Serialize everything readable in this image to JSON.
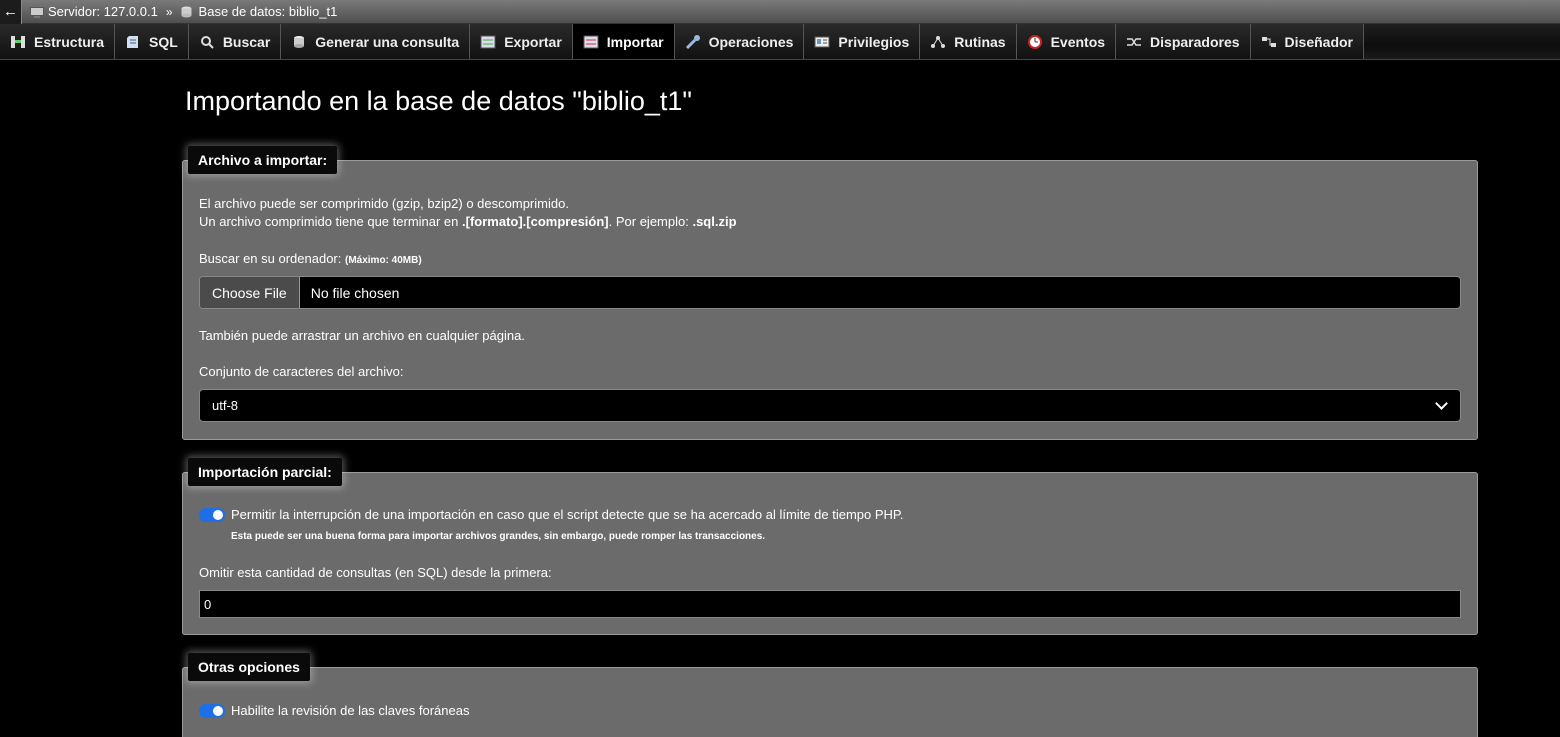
{
  "breadcrumb": {
    "back": "←",
    "server": "Servidor: 127.0.0.1",
    "separator": "»",
    "database": "Base de datos: biblio_t1"
  },
  "tabs": [
    {
      "label": "Estructura",
      "icon": "structure-icon"
    },
    {
      "label": "SQL",
      "icon": "sql-icon"
    },
    {
      "label": "Buscar",
      "icon": "search-icon"
    },
    {
      "label": "Generar una consulta",
      "icon": "query-icon"
    },
    {
      "label": "Exportar",
      "icon": "export-icon"
    },
    {
      "label": "Importar",
      "icon": "import-icon",
      "active": true
    },
    {
      "label": "Operaciones",
      "icon": "wrench-icon"
    },
    {
      "label": "Privilegios",
      "icon": "privileges-icon"
    },
    {
      "label": "Rutinas",
      "icon": "routines-icon"
    },
    {
      "label": "Eventos",
      "icon": "events-icon"
    },
    {
      "label": "Disparadores",
      "icon": "triggers-icon"
    },
    {
      "label": "Diseñador",
      "icon": "designer-icon"
    }
  ],
  "page_title": "Importando en la base de datos \"biblio_t1\"",
  "file_section": {
    "legend": "Archivo a importar:",
    "line1": "El archivo puede ser comprimido (gzip, bzip2) o descomprimido.",
    "line2_prefix": "Un archivo comprimido tiene que terminar en ",
    "line2_format": ".[formato].[compresión]",
    "line2_mid": ". Por ejemplo: ",
    "line2_example": ".sql.zip",
    "browse_label": "Buscar en su ordenador:",
    "max_size": "(Máximo: 40MB)",
    "choose_button": "Choose File",
    "no_file": "No file chosen",
    "drag_hint": "También puede arrastrar un archivo en cualquier página.",
    "charset_label": "Conjunto de caracteres del archivo:",
    "charset_value": "utf-8"
  },
  "partial_section": {
    "legend": "Importación parcial:",
    "allow_interrupt": "Permitir la interrupción de una importación en caso que el script detecte que se ha acercado al límite de tiempo PHP.",
    "allow_interrupt_hint": "Esta puede ser una buena forma para importar archivos grandes, sin embargo, puede romper las transacciones.",
    "allow_interrupt_enabled": true,
    "skip_label": "Omitir esta cantidad de consultas (en SQL) desde la primera:",
    "skip_value": "0"
  },
  "other_section": {
    "legend": "Otras opciones",
    "fk_check": "Habilite la revisión de las claves foráneas",
    "fk_check_enabled": true
  }
}
